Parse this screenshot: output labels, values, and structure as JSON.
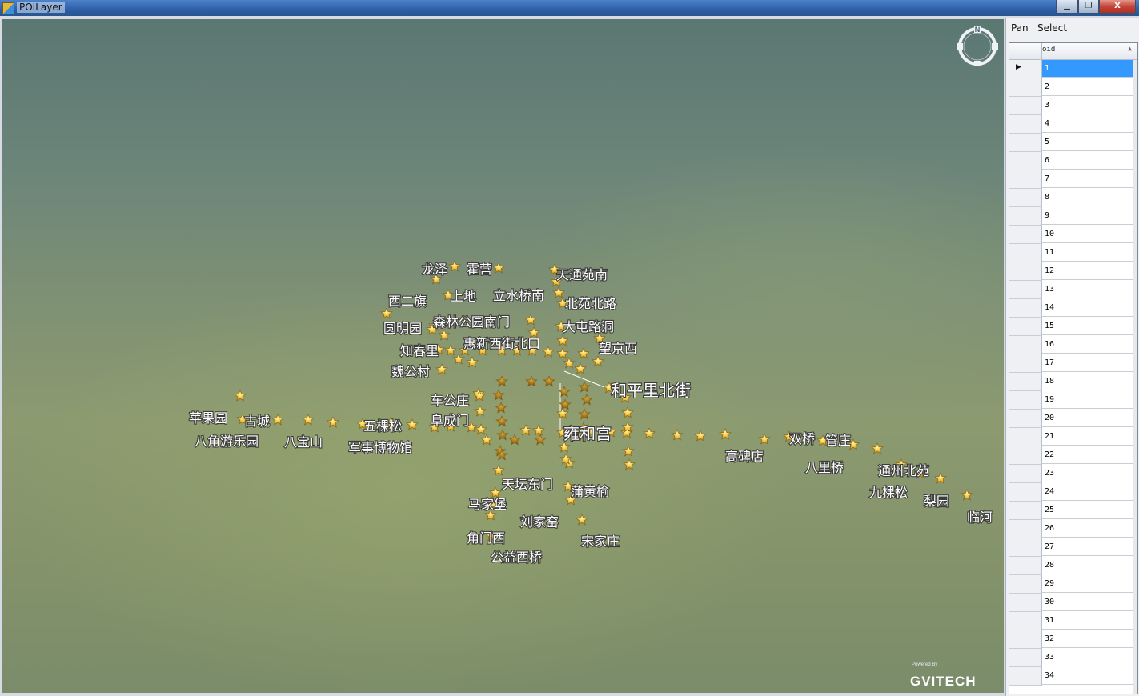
{
  "window": {
    "title": "POILayer",
    "min_label": "▁",
    "max_label": "❐",
    "close_label": "X"
  },
  "toolbar": {
    "pan_label": "Pan",
    "select_label": "Select"
  },
  "grid": {
    "column_header": "oid",
    "rows": [
      "1",
      "2",
      "3",
      "4",
      "5",
      "6",
      "7",
      "8",
      "9",
      "10",
      "11",
      "12",
      "13",
      "14",
      "15",
      "16",
      "17",
      "18",
      "19",
      "20",
      "21",
      "22",
      "23",
      "24",
      "25",
      "26",
      "27",
      "28",
      "29",
      "30",
      "31",
      "32",
      "33",
      "34"
    ],
    "selected_row": "1"
  },
  "compass": {
    "label": "N"
  },
  "logo": {
    "small": "Powered By",
    "brand": "GVITECH"
  },
  "map": {
    "labels": [
      "龙泽",
      "霍营",
      "天通苑南",
      "西二旗",
      "上地",
      "立水桥南",
      "北苑北路",
      "森林公园南门",
      "圆明园",
      "大屯路洞",
      "知春里",
      "惠新西街北口",
      "望京西",
      "魏公村",
      "和平里北街",
      "车公庄",
      "阜成门",
      "苹果园",
      "古城",
      "五棵松",
      "雍和宫",
      "八角游乐园",
      "八宝山",
      "军事博物馆",
      "高碑店",
      "双桥",
      "管庄",
      "八里桥",
      "通州北苑",
      "九棵松",
      "梨园",
      "临河",
      "天坛东门",
      "蒲黄榆",
      "马家堡",
      "刘家窑",
      "角门西",
      "宋家庄",
      "公益西桥"
    ],
    "star_color": "#e8b22a"
  }
}
